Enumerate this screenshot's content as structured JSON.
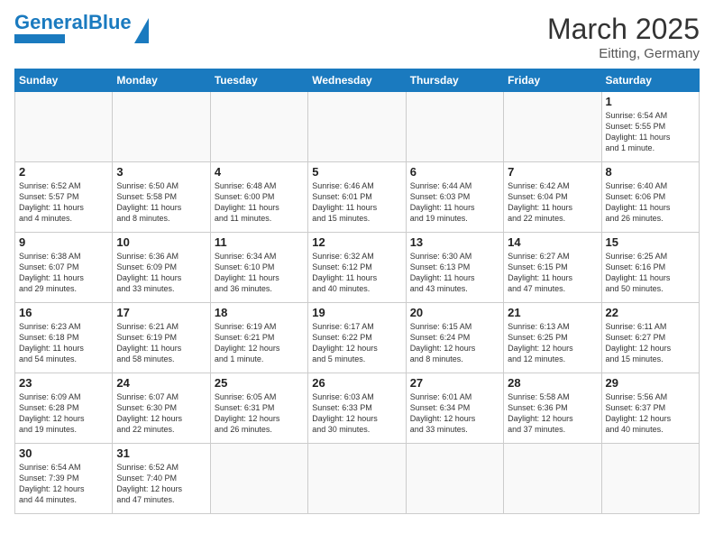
{
  "header": {
    "logo_general": "General",
    "logo_blue": "Blue",
    "title": "March 2025",
    "location": "Eitting, Germany"
  },
  "weekdays": [
    "Sunday",
    "Monday",
    "Tuesday",
    "Wednesday",
    "Thursday",
    "Friday",
    "Saturday"
  ],
  "weeks": [
    [
      {
        "day": "",
        "info": ""
      },
      {
        "day": "",
        "info": ""
      },
      {
        "day": "",
        "info": ""
      },
      {
        "day": "",
        "info": ""
      },
      {
        "day": "",
        "info": ""
      },
      {
        "day": "",
        "info": ""
      },
      {
        "day": "1",
        "info": "Sunrise: 6:54 AM\nSunset: 5:55 PM\nDaylight: 11 hours\nand 1 minute."
      }
    ],
    [
      {
        "day": "2",
        "info": "Sunrise: 6:52 AM\nSunset: 5:57 PM\nDaylight: 11 hours\nand 4 minutes."
      },
      {
        "day": "3",
        "info": "Sunrise: 6:50 AM\nSunset: 5:58 PM\nDaylight: 11 hours\nand 8 minutes."
      },
      {
        "day": "4",
        "info": "Sunrise: 6:48 AM\nSunset: 6:00 PM\nDaylight: 11 hours\nand 11 minutes."
      },
      {
        "day": "5",
        "info": "Sunrise: 6:46 AM\nSunset: 6:01 PM\nDaylight: 11 hours\nand 15 minutes."
      },
      {
        "day": "6",
        "info": "Sunrise: 6:44 AM\nSunset: 6:03 PM\nDaylight: 11 hours\nand 19 minutes."
      },
      {
        "day": "7",
        "info": "Sunrise: 6:42 AM\nSunset: 6:04 PM\nDaylight: 11 hours\nand 22 minutes."
      },
      {
        "day": "8",
        "info": "Sunrise: 6:40 AM\nSunset: 6:06 PM\nDaylight: 11 hours\nand 26 minutes."
      }
    ],
    [
      {
        "day": "9",
        "info": "Sunrise: 6:38 AM\nSunset: 6:07 PM\nDaylight: 11 hours\nand 29 minutes."
      },
      {
        "day": "10",
        "info": "Sunrise: 6:36 AM\nSunset: 6:09 PM\nDaylight: 11 hours\nand 33 minutes."
      },
      {
        "day": "11",
        "info": "Sunrise: 6:34 AM\nSunset: 6:10 PM\nDaylight: 11 hours\nand 36 minutes."
      },
      {
        "day": "12",
        "info": "Sunrise: 6:32 AM\nSunset: 6:12 PM\nDaylight: 11 hours\nand 40 minutes."
      },
      {
        "day": "13",
        "info": "Sunrise: 6:30 AM\nSunset: 6:13 PM\nDaylight: 11 hours\nand 43 minutes."
      },
      {
        "day": "14",
        "info": "Sunrise: 6:27 AM\nSunset: 6:15 PM\nDaylight: 11 hours\nand 47 minutes."
      },
      {
        "day": "15",
        "info": "Sunrise: 6:25 AM\nSunset: 6:16 PM\nDaylight: 11 hours\nand 50 minutes."
      }
    ],
    [
      {
        "day": "16",
        "info": "Sunrise: 6:23 AM\nSunset: 6:18 PM\nDaylight: 11 hours\nand 54 minutes."
      },
      {
        "day": "17",
        "info": "Sunrise: 6:21 AM\nSunset: 6:19 PM\nDaylight: 11 hours\nand 58 minutes."
      },
      {
        "day": "18",
        "info": "Sunrise: 6:19 AM\nSunset: 6:21 PM\nDaylight: 12 hours\nand 1 minute."
      },
      {
        "day": "19",
        "info": "Sunrise: 6:17 AM\nSunset: 6:22 PM\nDaylight: 12 hours\nand 5 minutes."
      },
      {
        "day": "20",
        "info": "Sunrise: 6:15 AM\nSunset: 6:24 PM\nDaylight: 12 hours\nand 8 minutes."
      },
      {
        "day": "21",
        "info": "Sunrise: 6:13 AM\nSunset: 6:25 PM\nDaylight: 12 hours\nand 12 minutes."
      },
      {
        "day": "22",
        "info": "Sunrise: 6:11 AM\nSunset: 6:27 PM\nDaylight: 12 hours\nand 15 minutes."
      }
    ],
    [
      {
        "day": "23",
        "info": "Sunrise: 6:09 AM\nSunset: 6:28 PM\nDaylight: 12 hours\nand 19 minutes."
      },
      {
        "day": "24",
        "info": "Sunrise: 6:07 AM\nSunset: 6:30 PM\nDaylight: 12 hours\nand 22 minutes."
      },
      {
        "day": "25",
        "info": "Sunrise: 6:05 AM\nSunset: 6:31 PM\nDaylight: 12 hours\nand 26 minutes."
      },
      {
        "day": "26",
        "info": "Sunrise: 6:03 AM\nSunset: 6:33 PM\nDaylight: 12 hours\nand 30 minutes."
      },
      {
        "day": "27",
        "info": "Sunrise: 6:01 AM\nSunset: 6:34 PM\nDaylight: 12 hours\nand 33 minutes."
      },
      {
        "day": "28",
        "info": "Sunrise: 5:58 AM\nSunset: 6:36 PM\nDaylight: 12 hours\nand 37 minutes."
      },
      {
        "day": "29",
        "info": "Sunrise: 5:56 AM\nSunset: 6:37 PM\nDaylight: 12 hours\nand 40 minutes."
      }
    ],
    [
      {
        "day": "30",
        "info": "Sunrise: 6:54 AM\nSunset: 7:39 PM\nDaylight: 12 hours\nand 44 minutes."
      },
      {
        "day": "31",
        "info": "Sunrise: 6:52 AM\nSunset: 7:40 PM\nDaylight: 12 hours\nand 47 minutes."
      },
      {
        "day": "",
        "info": ""
      },
      {
        "day": "",
        "info": ""
      },
      {
        "day": "",
        "info": ""
      },
      {
        "day": "",
        "info": ""
      },
      {
        "day": "",
        "info": ""
      }
    ]
  ]
}
